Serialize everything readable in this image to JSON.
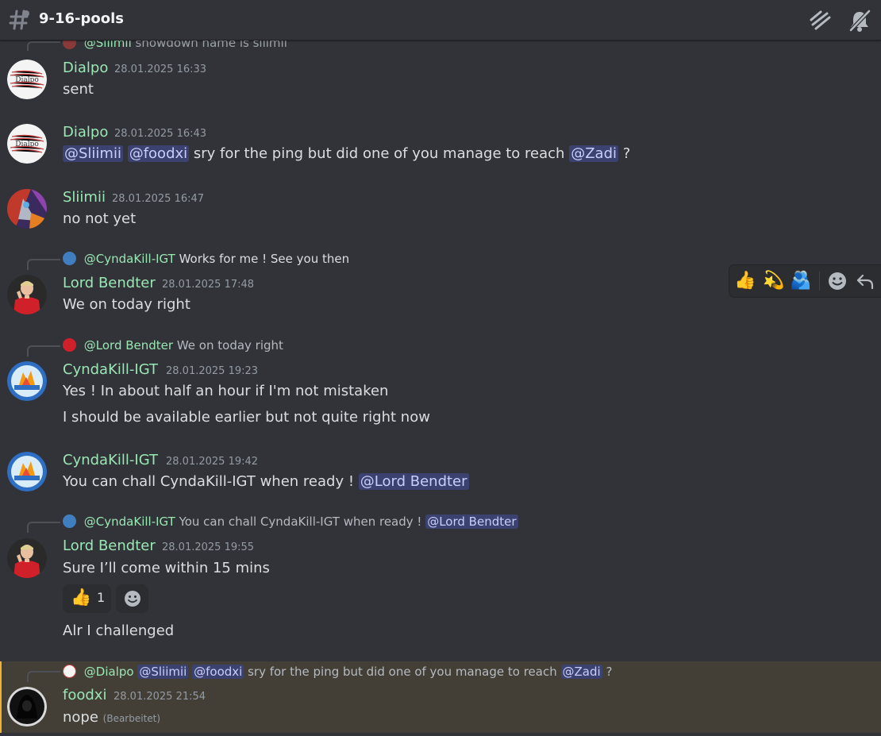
{
  "channel": {
    "name": "9-16-pools"
  },
  "top_partial_reply": {
    "mention": "@Sliimii",
    "text": "showdown name is sliimii"
  },
  "messages": [
    {
      "author": "Dialpo",
      "timestamp": "28.01.2025 16:33",
      "avatar_text": "Dialpo",
      "text": "sent"
    },
    {
      "author": "Dialpo",
      "timestamp": "28.01.2025 16:43",
      "avatar_text": "Dialpo",
      "mention1": "@Sliimii",
      "mention2": "@foodxi",
      "text_mid": "sry for the ping but did one of you manage to reach",
      "mention3": "@Zadi",
      "text_end": "?"
    },
    {
      "author": "Sliimii",
      "timestamp": "28.01.2025 16:47",
      "text": "no not yet"
    },
    {
      "author": "Lord Bendter",
      "timestamp": "28.01.2025 17:48",
      "reply": {
        "author": "@CyndaKill-IGT",
        "text": "Works for me ! See you then"
      },
      "text": "We on today right"
    },
    {
      "author": "CyndaKill-IGT",
      "timestamp": "28.01.2025 19:23",
      "reply": {
        "author": "@Lord Bendter",
        "text": "We on today right"
      },
      "text": "Yes ! In about half an hour if I'm not mistaken",
      "text2": "I should be available earlier but not quite right now"
    },
    {
      "author": "CyndaKill-IGT",
      "timestamp": "28.01.2025 19:42",
      "text": "You can chall CyndaKill-IGT when ready !",
      "mention": "@Lord Bendter"
    },
    {
      "author": "Lord Bendter",
      "timestamp": "28.01.2025 19:55",
      "reply": {
        "author": "@CyndaKill-IGT",
        "text": "You can chall CyndaKill-IGT when ready !",
        "mention": "@Lord Bendter"
      },
      "text": "Sure I’ll come within 15 mins",
      "reaction": {
        "emoji": "👍",
        "count": "1"
      },
      "text2": "Alr I challenged"
    },
    {
      "author": "foodxi",
      "timestamp": "28.01.2025 21:54",
      "reply": {
        "author": "@Dialpo",
        "mention1": "@Sliimii",
        "mention2": "@foodxi",
        "text": "sry for the ping but did one of you manage to reach",
        "mention3": "@Zadi",
        "end": "?"
      },
      "text": "nope",
      "edited": "(Bearbeitet)"
    }
  ],
  "hover_bar": {
    "emojis": [
      "👍",
      "💫",
      "🫂"
    ]
  },
  "colors": {
    "background": "#313338",
    "username": "#9ae6b4",
    "mention_bg": "#3c4270",
    "highlight": "#433f36"
  }
}
